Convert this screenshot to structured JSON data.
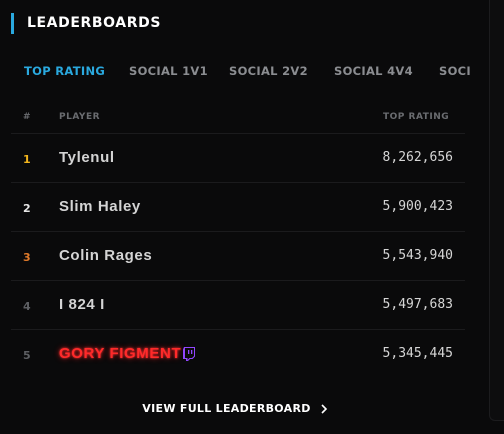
{
  "header": {
    "title": "LEADERBOARDS",
    "accent_color": "#2aa9df"
  },
  "tabs": [
    {
      "label": "TOP RATING",
      "active": true
    },
    {
      "label": "SOCIAL 1V1",
      "active": false
    },
    {
      "label": "SOCIAL 2V2",
      "active": false
    },
    {
      "label": "SOCIAL 4V4",
      "active": false
    },
    {
      "label": "SOCI",
      "active": false
    }
  ],
  "table": {
    "columns": {
      "rank": "#",
      "player": "PLAYER",
      "rating": "TOP RATING"
    },
    "rows": [
      {
        "rank": "1",
        "rank_color": "#f2b51d",
        "player": "Tylenul",
        "rating": "8,262,656"
      },
      {
        "rank": "2",
        "rank_color": "#e6e6e6",
        "player": "Slim Haley",
        "rating": "5,900,423"
      },
      {
        "rank": "3",
        "rank_color": "#e07a2a",
        "player": "Colin Rages",
        "rating": "5,543,940"
      },
      {
        "rank": "4",
        "rank_color": "#5d5f63",
        "player": "I 824 I",
        "rating": "5,497,683"
      },
      {
        "rank": "5",
        "rank_color": "#5d5f63",
        "player": "GORY FIGMENT",
        "rating": "5,345,445",
        "streamer": true,
        "icon": "twitch-icon",
        "name_color": "#ff2a2a"
      }
    ]
  },
  "footer": {
    "link_label": "VIEW FULL LEADERBOARD",
    "icon": "chevron-right-icon"
  }
}
